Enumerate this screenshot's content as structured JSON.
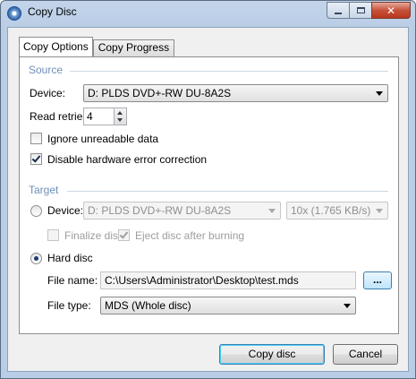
{
  "window": {
    "title": "Copy Disc"
  },
  "tabs": [
    {
      "label": "Copy Options",
      "active": true
    },
    {
      "label": "Copy Progress",
      "active": false
    }
  ],
  "source": {
    "group_label": "Source",
    "device_label": "Device:",
    "device_value": "D: PLDS DVD+-RW DU-8A2S",
    "retries_label": "Read retries:",
    "retries_value": "4",
    "ignore_unreadable_label": "Ignore unreadable data",
    "ignore_unreadable_checked": false,
    "disable_hw_correction_label": "Disable hardware error correction",
    "disable_hw_correction_checked": true
  },
  "target": {
    "group_label": "Target",
    "device_radio_label": "Device:",
    "device_value": "D: PLDS DVD+-RW DU-8A2S",
    "speed_value": "10x (1.765 KB/s)",
    "finalize_label": "Finalize disc",
    "finalize_checked": false,
    "eject_label": "Eject disc after burning",
    "eject_checked": true,
    "hard_disc_label": "Hard disc",
    "hard_disc_selected": true,
    "file_name_label": "File name:",
    "file_name_value": "C:\\Users\\Administrator\\Desktop\\test.mds",
    "browse_label": "...",
    "file_type_label": "File type:",
    "file_type_value": "MDS (Whole disc)"
  },
  "buttons": {
    "copy": "Copy disc",
    "cancel": "Cancel"
  },
  "colors": {
    "group_label": "#6d8fb9",
    "title_bar": "#b9cde6",
    "close_button": "#c7513a"
  },
  "icons": {
    "app": "disc-icon",
    "minimize": "minimize-icon",
    "maximize": "maximize-icon",
    "close": "close-icon"
  }
}
